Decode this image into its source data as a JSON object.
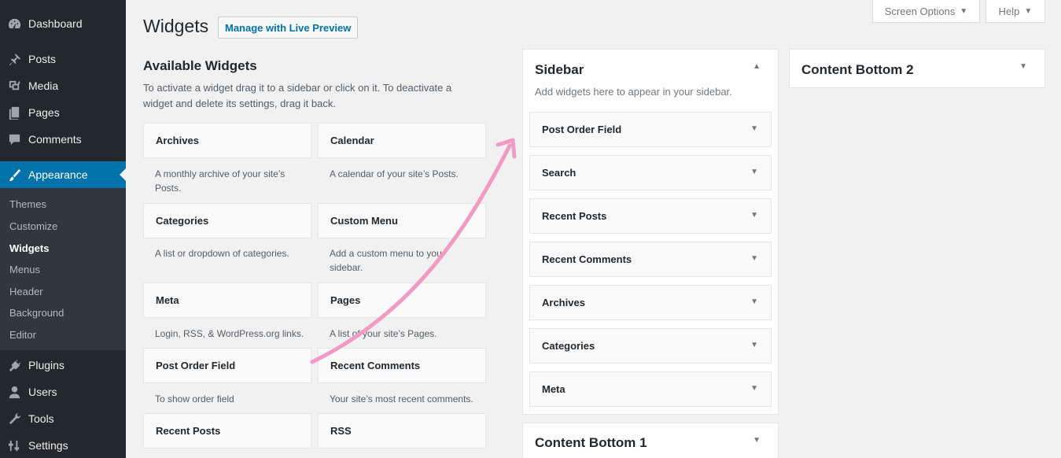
{
  "admin_menu": {
    "items": [
      {
        "label": "Dashboard",
        "icon": "dashboard-icon"
      },
      {
        "label": "Posts",
        "icon": "pin-icon"
      },
      {
        "label": "Media",
        "icon": "media-icon"
      },
      {
        "label": "Pages",
        "icon": "pages-icon"
      },
      {
        "label": "Comments",
        "icon": "comment-icon"
      },
      {
        "label": "Appearance",
        "icon": "brush-icon"
      },
      {
        "label": "Plugins",
        "icon": "plug-icon"
      },
      {
        "label": "Users",
        "icon": "user-icon"
      },
      {
        "label": "Tools",
        "icon": "wrench-icon"
      },
      {
        "label": "Settings",
        "icon": "settings-icon"
      }
    ],
    "submenu": [
      "Themes",
      "Customize",
      "Widgets",
      "Menus",
      "Header",
      "Background",
      "Editor"
    ]
  },
  "header": {
    "title": "Widgets",
    "live_preview": "Manage with Live Preview",
    "screen_options": "Screen Options",
    "help": "Help"
  },
  "available": {
    "title": "Available Widgets",
    "description": "To activate a widget drag it to a sidebar or click on it. To deactivate a widget and delete its settings, drag it back.",
    "widgets": [
      {
        "name": "Archives",
        "desc": "A monthly archive of your site’s Posts."
      },
      {
        "name": "Calendar",
        "desc": "A calendar of your site’s Posts."
      },
      {
        "name": "Categories",
        "desc": "A list or dropdown of categories."
      },
      {
        "name": "Custom Menu",
        "desc": "Add a custom menu to your sidebar."
      },
      {
        "name": "Meta",
        "desc": "Login, RSS, & WordPress.org links."
      },
      {
        "name": "Pages",
        "desc": "A list of your site’s Pages."
      },
      {
        "name": "Post Order Field",
        "desc": "To show order field"
      },
      {
        "name": "Recent Comments",
        "desc": "Your site’s most recent comments."
      },
      {
        "name": "Recent Posts",
        "desc": ""
      },
      {
        "name": "RSS",
        "desc": ""
      }
    ]
  },
  "sidebar": {
    "title": "Sidebar",
    "description": "Add widgets here to appear in your sidebar.",
    "widgets": [
      "Post Order Field",
      "Search",
      "Recent Posts",
      "Recent Comments",
      "Archives",
      "Categories",
      "Meta"
    ]
  },
  "content_bottom_1": {
    "title": "Content Bottom 1"
  },
  "content_bottom_2": {
    "title": "Content Bottom 2"
  },
  "colors": {
    "accent": "#0073aa",
    "arrow": "#f29ac4",
    "menu_bg": "#23282d"
  }
}
